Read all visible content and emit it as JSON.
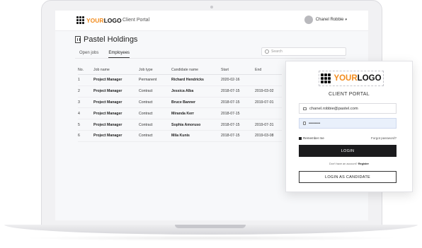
{
  "header": {
    "logo_your": "YOUR",
    "logo_word": "LOGO",
    "portal_label": "Client Portal",
    "user_name": "Chanel Robbie",
    "user_caret": "▾"
  },
  "company": {
    "name": "Pastel Holdings"
  },
  "tabs": [
    {
      "label": "Open jobs"
    },
    {
      "label": "Employees"
    }
  ],
  "search": {
    "placeholder": "Search"
  },
  "table": {
    "columns": [
      "No.",
      "Job name",
      "Job type",
      "Candidate name",
      "Start",
      "End"
    ],
    "rows": [
      [
        "1",
        "Project Manager",
        "Permanent",
        "Richard Hendricks",
        "2020-02-16",
        ""
      ],
      [
        "2",
        "Project Manager",
        "Contract",
        "Jessica Alba",
        "2018-07-15",
        "2019-03-02"
      ],
      [
        "3",
        "Project Manager",
        "Contract",
        "Bruce Banner",
        "2018-07-15",
        "2019-07-01"
      ],
      [
        "4",
        "Project Manager",
        "Contract",
        "Miranda Kerr",
        "2018-07-15",
        ""
      ],
      [
        "5",
        "Project Manager",
        "Contract",
        "Sophia Amoruso",
        "2018-07-15",
        "2019-07-31"
      ],
      [
        "6",
        "Project Manager",
        "Contract",
        "Mila Kunis",
        "2018-07-15",
        "2019-03-08"
      ]
    ]
  },
  "login": {
    "logo_your": "YOUR",
    "logo_word": "LOGO",
    "title": "CLIENT PORTAL",
    "email_value": "chanel.robbie@pastel.com",
    "password_value": "••••••••",
    "remember_label": "Remember me",
    "forgot_label": "Forgot password?",
    "login_button": "LOGIN",
    "no_account_text": "Don't have an account?",
    "register_link": "Register",
    "candidate_button": "LOGIN AS CANDIDATE"
  },
  "colors": {
    "accent": "#f28c1e",
    "button_dark": "#1b1b1d",
    "password_bg": "#e9f0fb"
  }
}
